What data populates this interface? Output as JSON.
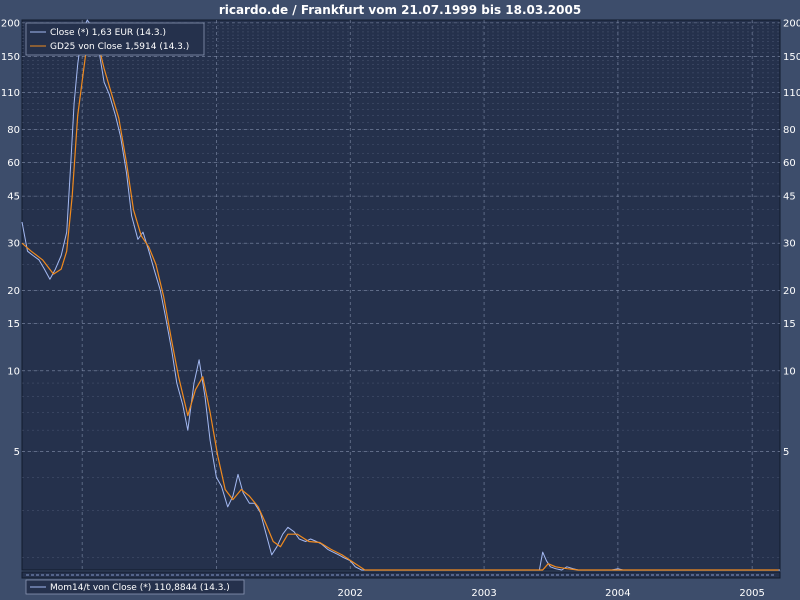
{
  "colors": {
    "background": "#3d4d6b",
    "plot_background": "#25314c",
    "grid": "#8a97b3",
    "close_line": "#a4b9f2",
    "gd25_line": "#f08a1e",
    "text": "#ffffff"
  },
  "chart_data": {
    "type": "line",
    "title": "ricardo.de / Frankfurt  vom 21.07.1999  bis 18.03.2005",
    "y_scale": "log",
    "ylim": [
      1.8,
      205
    ],
    "xlim": [
      "1999-07-21",
      "2005-03-18"
    ],
    "y_ticks": [
      5,
      10,
      15,
      20,
      30,
      45,
      60,
      80,
      110,
      150,
      200
    ],
    "y_tick_labels": [
      "5",
      "10",
      "15",
      "20",
      "30",
      "45",
      "60",
      "80",
      "110",
      "150",
      "200"
    ],
    "x_ticks": [
      "2000-01-01",
      "2001-01-01",
      "2002-01-01",
      "2003-01-01",
      "2004-01-01",
      "2005-01-01"
    ],
    "x_tick_labels": [
      "",
      "",
      "2002",
      "2003",
      "2004",
      "2005"
    ],
    "grid": true,
    "legend_position": "top-left",
    "series": [
      {
        "name": "Close (*) 1,63 EUR (14.3.)",
        "points": [
          [
            "1999-07-21",
            36
          ],
          [
            "1999-08-05",
            28
          ],
          [
            "1999-08-20",
            27
          ],
          [
            "1999-09-05",
            26
          ],
          [
            "1999-09-20",
            24
          ],
          [
            "1999-10-05",
            22
          ],
          [
            "1999-10-20",
            24
          ],
          [
            "1999-11-05",
            27
          ],
          [
            "1999-11-20",
            33
          ],
          [
            "1999-12-01",
            60
          ],
          [
            "1999-12-10",
            100
          ],
          [
            "1999-12-20",
            140
          ],
          [
            "2000-01-01",
            185
          ],
          [
            "2000-01-15",
            205
          ],
          [
            "2000-02-01",
            190
          ],
          [
            "2000-02-15",
            160
          ],
          [
            "2000-03-01",
            120
          ],
          [
            "2000-03-15",
            108
          ],
          [
            "2000-04-01",
            90
          ],
          [
            "2000-04-15",
            75
          ],
          [
            "2000-05-01",
            55
          ],
          [
            "2000-05-15",
            38
          ],
          [
            "2000-06-01",
            31
          ],
          [
            "2000-06-15",
            33
          ],
          [
            "2000-07-01",
            28
          ],
          [
            "2000-07-15",
            24
          ],
          [
            "2000-08-01",
            20
          ],
          [
            "2000-08-15",
            16
          ],
          [
            "2000-09-01",
            12
          ],
          [
            "2000-09-15",
            9
          ],
          [
            "2000-10-01",
            7.5
          ],
          [
            "2000-10-15",
            6
          ],
          [
            "2000-11-01",
            9
          ],
          [
            "2000-11-15",
            11
          ],
          [
            "2000-12-01",
            8
          ],
          [
            "2000-12-15",
            5.5
          ],
          [
            "2001-01-01",
            4.0
          ],
          [
            "2001-01-15",
            3.7
          ],
          [
            "2001-02-01",
            3.1
          ],
          [
            "2001-02-15",
            3.4
          ],
          [
            "2001-03-01",
            4.1
          ],
          [
            "2001-03-15",
            3.5
          ],
          [
            "2001-04-01",
            3.2
          ],
          [
            "2001-04-15",
            3.2
          ],
          [
            "2001-05-01",
            2.95
          ],
          [
            "2001-05-15",
            2.5
          ],
          [
            "2001-06-01",
            2.05
          ],
          [
            "2001-06-15",
            2.2
          ],
          [
            "2001-07-01",
            2.45
          ],
          [
            "2001-07-15",
            2.6
          ],
          [
            "2001-08-01",
            2.5
          ],
          [
            "2001-08-15",
            2.35
          ],
          [
            "2001-09-01",
            2.3
          ],
          [
            "2001-09-15",
            2.35
          ],
          [
            "2001-10-01",
            2.3
          ],
          [
            "2001-10-15",
            2.25
          ],
          [
            "2001-11-01",
            2.15
          ],
          [
            "2001-11-15",
            2.1
          ],
          [
            "2001-12-01",
            2.05
          ],
          [
            "2001-12-15",
            2.0
          ],
          [
            "2002-01-01",
            1.95
          ],
          [
            "2002-01-15",
            1.85
          ],
          [
            "2002-02-01",
            1.75
          ],
          [
            "2002-02-15",
            1.6
          ],
          [
            "2002-03-01",
            1.55
          ],
          [
            "2002-03-15",
            1.5
          ],
          [
            "2002-04-01",
            1.45
          ],
          [
            "2002-04-15",
            1.5
          ],
          [
            "2002-05-01",
            1.48
          ],
          [
            "2002-05-15",
            1.45
          ],
          [
            "2002-06-01",
            1.45
          ],
          [
            "2002-06-15",
            1.4
          ],
          [
            "2002-07-01",
            1.35
          ],
          [
            "2002-07-15",
            1.35
          ],
          [
            "2002-08-01",
            1.35
          ],
          [
            "2002-08-15",
            1.3
          ],
          [
            "2002-09-01",
            1.28
          ],
          [
            "2002-09-15",
            1.35
          ],
          [
            "2002-10-01",
            1.25
          ],
          [
            "2002-10-15",
            1.2
          ],
          [
            "2002-11-01",
            1.15
          ],
          [
            "2002-11-15",
            1.1
          ],
          [
            "2002-12-01",
            1.12
          ],
          [
            "2002-12-15",
            1.15
          ],
          [
            "2003-01-01",
            1.1
          ],
          [
            "2003-01-15",
            1.0
          ],
          [
            "2003-02-01",
            1.08
          ],
          [
            "2003-02-15",
            0.98
          ],
          [
            "2003-03-01",
            0.95
          ],
          [
            "2003-03-15",
            0.96
          ],
          [
            "2003-04-01",
            1.0
          ],
          [
            "2003-04-15",
            1.02
          ],
          [
            "2003-05-01",
            1.05
          ],
          [
            "2003-05-15",
            1.1
          ],
          [
            "2003-06-01",
            1.8
          ],
          [
            "2003-06-10",
            2.1
          ],
          [
            "2003-06-20",
            1.95
          ],
          [
            "2003-07-01",
            1.85
          ],
          [
            "2003-07-15",
            1.82
          ],
          [
            "2003-08-01",
            1.8
          ],
          [
            "2003-08-15",
            1.85
          ],
          [
            "2003-09-01",
            1.82
          ],
          [
            "2003-09-15",
            1.8
          ],
          [
            "2003-10-01",
            1.78
          ],
          [
            "2003-10-15",
            1.75
          ],
          [
            "2003-11-01",
            1.72
          ],
          [
            "2003-11-15",
            1.72
          ],
          [
            "2003-12-01",
            1.75
          ],
          [
            "2003-12-15",
            1.8
          ],
          [
            "2004-01-01",
            1.82
          ],
          [
            "2004-01-15",
            1.75
          ],
          [
            "2004-02-01",
            1.7
          ],
          [
            "2004-02-15",
            1.65
          ],
          [
            "2004-03-01",
            1.62
          ],
          [
            "2004-03-15",
            1.6
          ],
          [
            "2004-04-01",
            1.6
          ],
          [
            "2004-04-15",
            1.62
          ],
          [
            "2004-05-01",
            1.6
          ],
          [
            "2004-05-15",
            1.58
          ],
          [
            "2004-06-01",
            1.57
          ],
          [
            "2004-06-15",
            1.56
          ],
          [
            "2004-07-01",
            1.55
          ],
          [
            "2004-07-15",
            1.55
          ],
          [
            "2004-08-01",
            1.52
          ],
          [
            "2004-08-15",
            1.5
          ],
          [
            "2004-09-01",
            1.48
          ],
          [
            "2004-09-15",
            1.45
          ],
          [
            "2004-10-01",
            1.4
          ],
          [
            "2004-10-15",
            1.3
          ],
          [
            "2004-11-01",
            1.55
          ],
          [
            "2004-11-15",
            1.7
          ],
          [
            "2004-12-01",
            1.65
          ],
          [
            "2004-12-15",
            1.68
          ],
          [
            "2005-01-01",
            1.7
          ],
          [
            "2005-01-15",
            1.65
          ],
          [
            "2005-02-01",
            1.66
          ],
          [
            "2005-02-15",
            1.68
          ],
          [
            "2005-03-01",
            1.64
          ],
          [
            "2005-03-18",
            1.63
          ]
        ]
      },
      {
        "name": "GD25 von Close 1,5914 (14.3.)",
        "points": [
          [
            "1999-07-21",
            30
          ],
          [
            "1999-08-15",
            28
          ],
          [
            "1999-09-15",
            26
          ],
          [
            "1999-10-15",
            23
          ],
          [
            "1999-11-05",
            24
          ],
          [
            "1999-11-20",
            28
          ],
          [
            "1999-12-05",
            45
          ],
          [
            "1999-12-20",
            90
          ],
          [
            "2000-01-10",
            150
          ],
          [
            "2000-01-25",
            190
          ],
          [
            "2000-02-10",
            175
          ],
          [
            "2000-03-01",
            135
          ],
          [
            "2000-03-20",
            110
          ],
          [
            "2000-04-10",
            88
          ],
          [
            "2000-05-01",
            60
          ],
          [
            "2000-05-20",
            40
          ],
          [
            "2000-06-10",
            32
          ],
          [
            "2000-07-01",
            29
          ],
          [
            "2000-07-20",
            25
          ],
          [
            "2000-08-10",
            19
          ],
          [
            "2000-09-01",
            13
          ],
          [
            "2000-09-20",
            9.5
          ],
          [
            "2000-10-15",
            6.8
          ],
          [
            "2000-11-05",
            8.5
          ],
          [
            "2000-11-25",
            9.5
          ],
          [
            "2000-12-15",
            7
          ],
          [
            "2001-01-05",
            4.8
          ],
          [
            "2001-01-25",
            3.6
          ],
          [
            "2001-02-15",
            3.3
          ],
          [
            "2001-03-10",
            3.6
          ],
          [
            "2001-04-01",
            3.4
          ],
          [
            "2001-04-25",
            3.1
          ],
          [
            "2001-05-15",
            2.7
          ],
          [
            "2001-06-05",
            2.3
          ],
          [
            "2001-06-25",
            2.2
          ],
          [
            "2001-07-15",
            2.45
          ],
          [
            "2001-08-10",
            2.45
          ],
          [
            "2001-09-10",
            2.3
          ],
          [
            "2001-10-10",
            2.28
          ],
          [
            "2001-11-10",
            2.15
          ],
          [
            "2001-12-10",
            2.05
          ],
          [
            "2002-01-10",
            1.92
          ],
          [
            "2002-02-10",
            1.72
          ],
          [
            "2002-03-10",
            1.55
          ],
          [
            "2002-04-10",
            1.48
          ],
          [
            "2002-05-10",
            1.47
          ],
          [
            "2002-06-10",
            1.43
          ],
          [
            "2002-07-10",
            1.37
          ],
          [
            "2002-08-10",
            1.33
          ],
          [
            "2002-09-10",
            1.3
          ],
          [
            "2002-10-10",
            1.24
          ],
          [
            "2002-11-10",
            1.15
          ],
          [
            "2002-12-10",
            1.12
          ],
          [
            "2003-01-10",
            1.08
          ],
          [
            "2003-02-10",
            1.03
          ],
          [
            "2003-03-10",
            0.97
          ],
          [
            "2003-04-10",
            1.0
          ],
          [
            "2003-05-10",
            1.06
          ],
          [
            "2003-05-25",
            1.12
          ],
          [
            "2003-06-10",
            1.6
          ],
          [
            "2003-06-25",
            1.9
          ],
          [
            "2003-07-15",
            1.85
          ],
          [
            "2003-08-15",
            1.82
          ],
          [
            "2003-09-15",
            1.8
          ],
          [
            "2003-10-15",
            1.76
          ],
          [
            "2003-11-15",
            1.73
          ],
          [
            "2003-12-15",
            1.77
          ],
          [
            "2004-01-15",
            1.78
          ],
          [
            "2004-02-15",
            1.68
          ],
          [
            "2004-03-15",
            1.62
          ],
          [
            "2004-04-15",
            1.61
          ],
          [
            "2004-05-15",
            1.59
          ],
          [
            "2004-06-15",
            1.57
          ],
          [
            "2004-07-15",
            1.55
          ],
          [
            "2004-08-15",
            1.51
          ],
          [
            "2004-09-15",
            1.47
          ],
          [
            "2004-10-15",
            1.38
          ],
          [
            "2004-11-05",
            1.45
          ],
          [
            "2004-11-25",
            1.62
          ],
          [
            "2004-12-15",
            1.66
          ],
          [
            "2005-01-15",
            1.67
          ],
          [
            "2005-02-15",
            1.66
          ],
          [
            "2005-03-14",
            1.59
          ]
        ]
      }
    ]
  },
  "lower_panel": {
    "legend": "Mom14/t von Close (*) 110,8844 (14.3.)"
  }
}
